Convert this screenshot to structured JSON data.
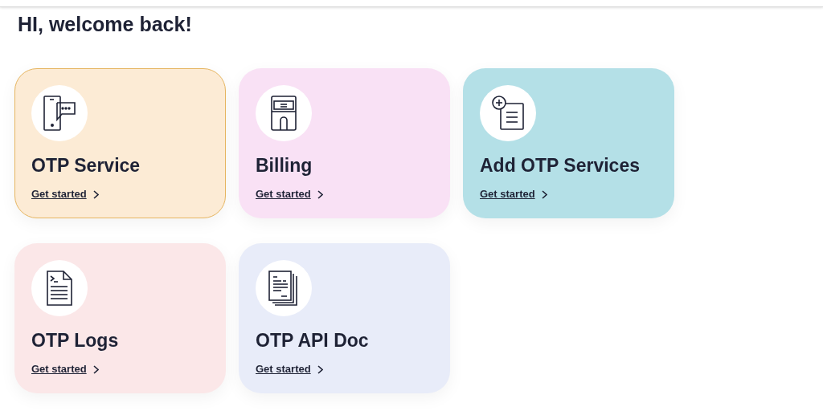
{
  "greeting": "HI, welcome back!",
  "cards": [
    {
      "kind": "phone",
      "title": "OTP Service",
      "link": "Get started",
      "color": "#fcebd5",
      "selected": true
    },
    {
      "kind": "billing",
      "title": "Billing",
      "link": "Get started",
      "color": "#f9e1f5",
      "selected": false
    },
    {
      "kind": "add-doc",
      "title": "Add OTP Services",
      "link": "Get started",
      "color": "#b4e0e7",
      "selected": false
    },
    {
      "kind": "log",
      "title": "OTP Logs",
      "link": "Get started",
      "color": "#fbe7e8",
      "selected": false
    },
    {
      "kind": "docs",
      "title": "OTP API Doc",
      "link": "Get started",
      "color": "#e8ecf9",
      "selected": false
    }
  ]
}
